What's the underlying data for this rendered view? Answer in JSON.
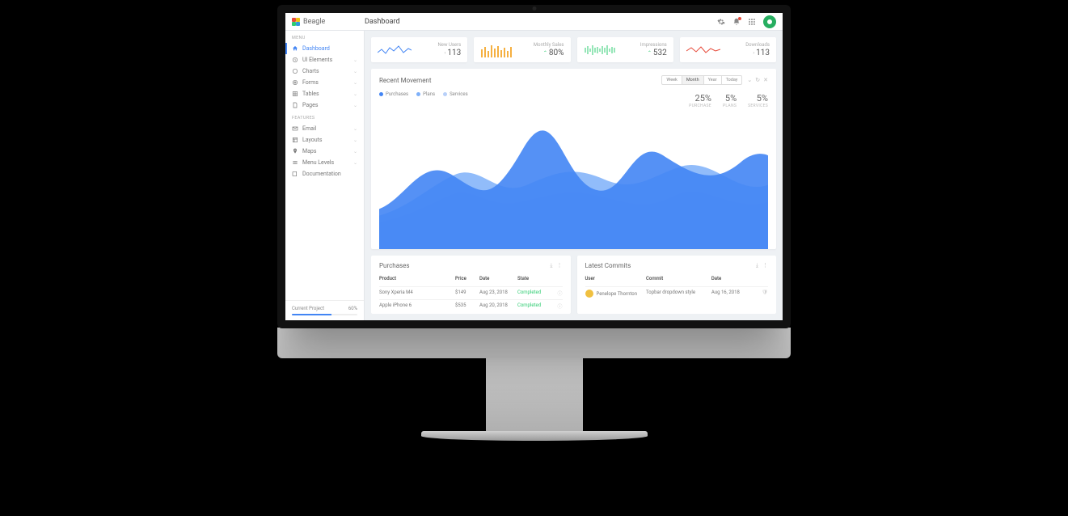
{
  "brand": {
    "name": "Beagle"
  },
  "page_title": "Dashboard",
  "sidebar": {
    "sections": {
      "menu": {
        "title": "MENU"
      },
      "features": {
        "title": "FEATURES"
      }
    },
    "menu_items": [
      {
        "label": "Dashboard",
        "icon": "home-icon",
        "active": true
      },
      {
        "label": "UI Elements",
        "icon": "watch-icon",
        "expandable": true
      },
      {
        "label": "Charts",
        "icon": "circle-icon",
        "expandable": true
      },
      {
        "label": "Forms",
        "icon": "target-icon",
        "expandable": true
      },
      {
        "label": "Tables",
        "icon": "grid-icon",
        "expandable": true
      },
      {
        "label": "Pages",
        "icon": "file-icon",
        "expandable": true
      }
    ],
    "feature_items": [
      {
        "label": "Email",
        "icon": "mail-icon",
        "expandable": true
      },
      {
        "label": "Layouts",
        "icon": "layout-icon",
        "expandable": true
      },
      {
        "label": "Maps",
        "icon": "pin-icon",
        "expandable": true
      },
      {
        "label": "Menu Levels",
        "icon": "menu-icon",
        "expandable": true
      },
      {
        "label": "Documentation",
        "icon": "book-icon",
        "expandable": false
      }
    ],
    "project": {
      "label": "Current Project",
      "percent": "60%"
    }
  },
  "stat_cards": [
    {
      "label": "New Users",
      "value": "113",
      "direction": "up",
      "color": "#4285f4",
      "spark": "line"
    },
    {
      "label": "Monthly Sales",
      "value": "80%",
      "direction": "up",
      "color": "#f5b041",
      "spark": "bars"
    },
    {
      "label": "Impressions",
      "value": "532",
      "direction": "up",
      "color": "#2ecc71",
      "spark": "pulse"
    },
    {
      "label": "Downloads",
      "value": "113",
      "direction": "up",
      "color": "#e74c3c",
      "spark": "line"
    }
  ],
  "movement": {
    "title": "Recent Movement",
    "legend": [
      "Purchases",
      "Plans",
      "Services"
    ],
    "time_options": [
      "Week",
      "Month",
      "Year",
      "Today"
    ],
    "time_active": "Month",
    "stats": [
      {
        "value": "25%",
        "label": "PURCHASE"
      },
      {
        "value": "5%",
        "label": "PLANS"
      },
      {
        "value": "5%",
        "label": "SERVICES"
      }
    ]
  },
  "purchases": {
    "title": "Purchases",
    "columns": [
      "Product",
      "Price",
      "Date",
      "State"
    ],
    "rows": [
      {
        "product": "Sony Xperia M4",
        "price": "$149",
        "date": "Aug 23, 2018",
        "state": "Completed"
      },
      {
        "product": "Apple iPhone 6",
        "price": "$535",
        "date": "Aug 20, 2018",
        "state": "Completed"
      }
    ]
  },
  "commits": {
    "title": "Latest Commits",
    "columns": [
      "User",
      "Commit",
      "Date"
    ],
    "rows": [
      {
        "user": "Penelope Thornton",
        "commit": "Topbar dropdown style",
        "date": "Aug 16, 2018"
      }
    ]
  },
  "chart_data": {
    "type": "area",
    "title": "Recent Movement",
    "xlabel": "",
    "ylabel": "",
    "x": [
      0,
      1,
      2,
      3,
      4,
      5,
      6,
      7,
      8,
      9,
      10,
      11
    ],
    "series": [
      {
        "name": "Purchases",
        "color": "#4285f4",
        "values": [
          20,
          28,
          60,
          35,
          25,
          70,
          40,
          30,
          72,
          45,
          35,
          65
        ]
      },
      {
        "name": "Plans",
        "color": "#7eb0f9",
        "values": [
          15,
          20,
          40,
          55,
          30,
          45,
          55,
          25,
          50,
          60,
          28,
          45
        ]
      },
      {
        "name": "Services",
        "color": "#b8d0f9",
        "values": [
          10,
          15,
          25,
          35,
          20,
          30,
          35,
          18,
          32,
          40,
          20,
          30
        ]
      }
    ],
    "ylim": [
      0,
      100
    ]
  }
}
